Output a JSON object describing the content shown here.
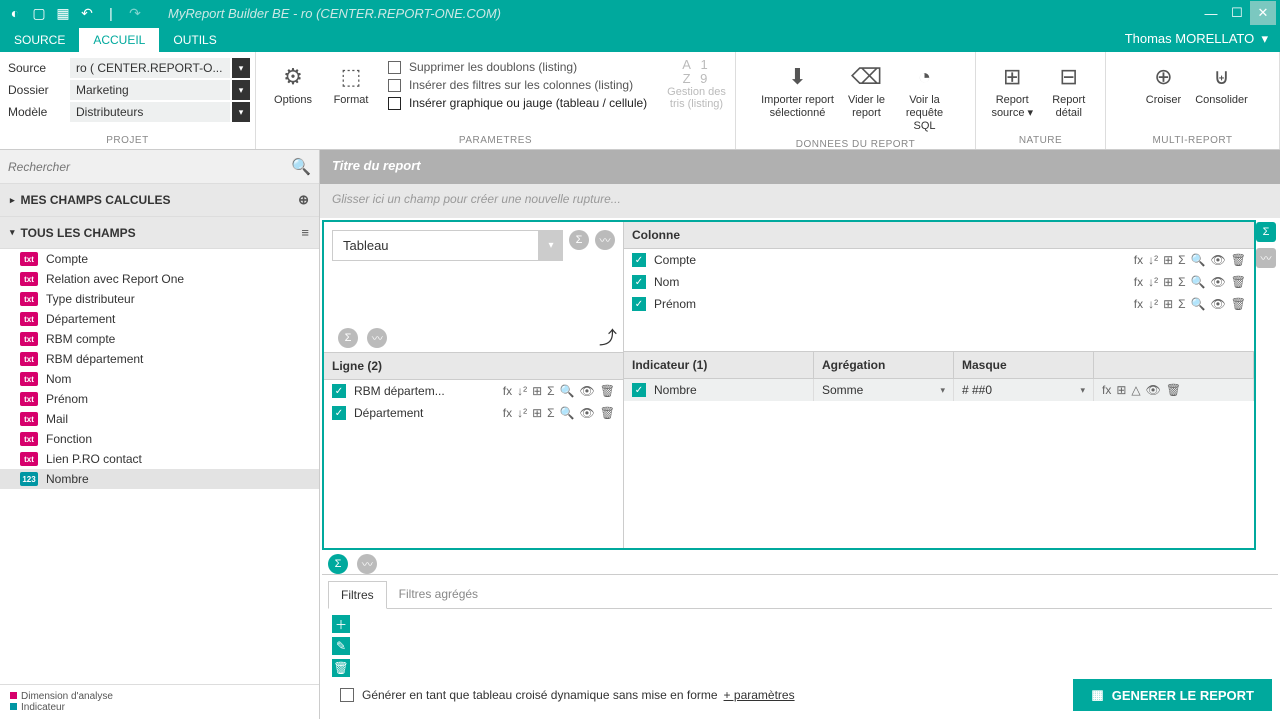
{
  "app": {
    "title": "MyReport Builder BE - ro (CENTER.REPORT-ONE.COM)"
  },
  "tabs": {
    "source": "SOURCE",
    "accueil": "ACCUEIL",
    "outils": "OUTILS"
  },
  "user": "Thomas MORELLATO",
  "project": {
    "labels": {
      "source": "Source",
      "dossier": "Dossier",
      "modele": "Modèle"
    },
    "values": {
      "source": "ro ( CENTER.REPORT-O...",
      "dossier": "Marketing",
      "modele": "Distributeurs"
    },
    "group": "PROJET"
  },
  "params": {
    "options": "Options",
    "format": "Format",
    "c1": "Supprimer les doublons (listing)",
    "c2": "Insérer des filtres sur les colonnes (listing)",
    "c3": "Insérer graphique ou jauge (tableau / cellule)",
    "tris1": "Gestion des",
    "tris2": "tris (listing)",
    "group": "PARAMETRES"
  },
  "donnees": {
    "importer1": "Importer report",
    "importer2": "sélectionné",
    "vider1": "Vider le",
    "vider2": "report",
    "voir1": "Voir la",
    "voir2": "requête SQL",
    "group": "DONNEES DU REPORT"
  },
  "nature": {
    "source1": "Report",
    "source2": "source",
    "detail1": "Report",
    "detail2": "détail",
    "group": "NATURE"
  },
  "multi": {
    "croiser": "Croiser",
    "consolider": "Consolider",
    "group": "MULTI-REPORT"
  },
  "sidebar": {
    "search_ph": "Rechercher",
    "calc": "MES CHAMPS CALCULES",
    "all": "TOUS LES CHAMPS",
    "fields": [
      {
        "t": "txt",
        "n": "Compte"
      },
      {
        "t": "txt",
        "n": "Relation avec Report One"
      },
      {
        "t": "txt",
        "n": "Type distributeur"
      },
      {
        "t": "txt",
        "n": "Département"
      },
      {
        "t": "txt",
        "n": "RBM compte"
      },
      {
        "t": "txt",
        "n": "RBM département"
      },
      {
        "t": "txt",
        "n": "Nom"
      },
      {
        "t": "txt",
        "n": "Prénom"
      },
      {
        "t": "txt",
        "n": "Mail"
      },
      {
        "t": "txt",
        "n": "Fonction"
      },
      {
        "t": "txt",
        "n": "Lien P.RO contact"
      },
      {
        "t": "num",
        "n": "Nombre"
      }
    ],
    "legend1": "Dimension d'analyse",
    "legend2": "Indicateur"
  },
  "work": {
    "title": "Titre du report",
    "drop": "Glisser ici un champ pour créer une nouvelle rupture...",
    "tableau": "Tableau",
    "colonne": "Colonne",
    "cols": [
      "Compte",
      "Nom",
      "Prénom"
    ],
    "ligne": "Ligne (2)",
    "lignes": [
      "RBM départem...",
      "Département"
    ],
    "indic_h": "Indicateur (1)",
    "agg_h": "Agrégation",
    "mask_h": "Masque",
    "indic_v": "Nombre",
    "agg_v": "Somme",
    "mask_v": "# ##0",
    "filtres": "Filtres",
    "filtres_agg": "Filtres agrégés",
    "gen_txt": "Générer en tant que tableau croisé dynamique sans mise en forme",
    "gen_plus": "+ paramètres",
    "gen_btn": "GENERER LE REPORT"
  }
}
